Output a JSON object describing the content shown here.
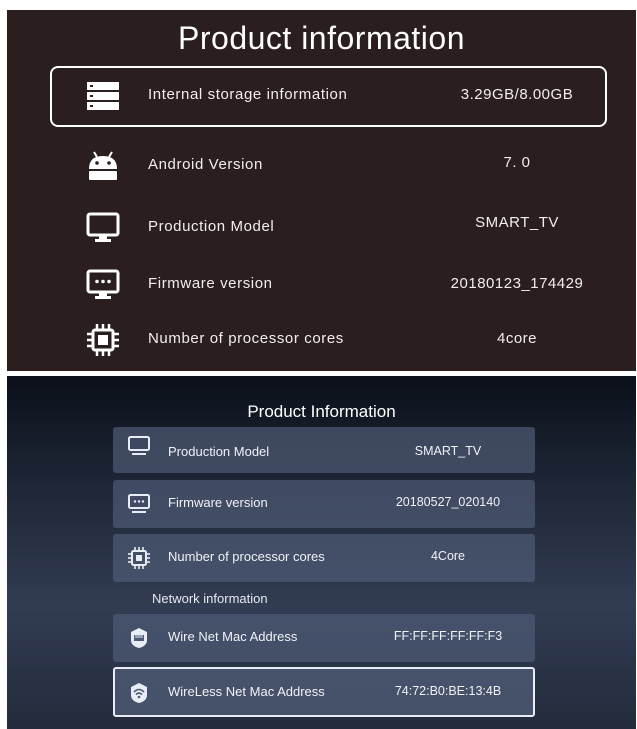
{
  "top_panel": {
    "title": "Product information",
    "rows": [
      {
        "label": "Internal storage information",
        "value": "3.29GB/8.00GB",
        "icon": "storage-icon",
        "selected": true
      },
      {
        "label": "Android Version",
        "value": "7. 0",
        "icon": "android-icon"
      },
      {
        "label": "Production Model",
        "value": "SMART_TV",
        "icon": "monitor-icon"
      },
      {
        "label": "Firmware version",
        "value": "20180123_174429",
        "icon": "firmware-icon"
      },
      {
        "label": "Number of processor cores",
        "value": "4core",
        "icon": "cpu-icon"
      }
    ]
  },
  "bottom_panel": {
    "title": "Product Information",
    "rows": [
      {
        "label": "Production Model",
        "value": "SMART_TV",
        "icon": "monitor-icon"
      },
      {
        "label": "Firmware version",
        "value": "20180527_020140",
        "icon": "firmware-icon"
      },
      {
        "label": "Number of processor cores",
        "value": "4Core",
        "icon": "cpu-icon"
      }
    ],
    "network_heading": "Network information",
    "network_rows": [
      {
        "label": "Wire Net Mac Address",
        "value": "FF:FF:FF:FF:FF:F3",
        "icon": "ethernet-icon"
      },
      {
        "label": "WireLess Net Mac Address",
        "value": "74:72:B0:BE:13:4B",
        "icon": "wifi-icon",
        "selected": true
      }
    ]
  },
  "colors": {
    "top_bg": "#2a1f1e",
    "bottom_bg": "#1e2636",
    "text": "#ffffff"
  }
}
